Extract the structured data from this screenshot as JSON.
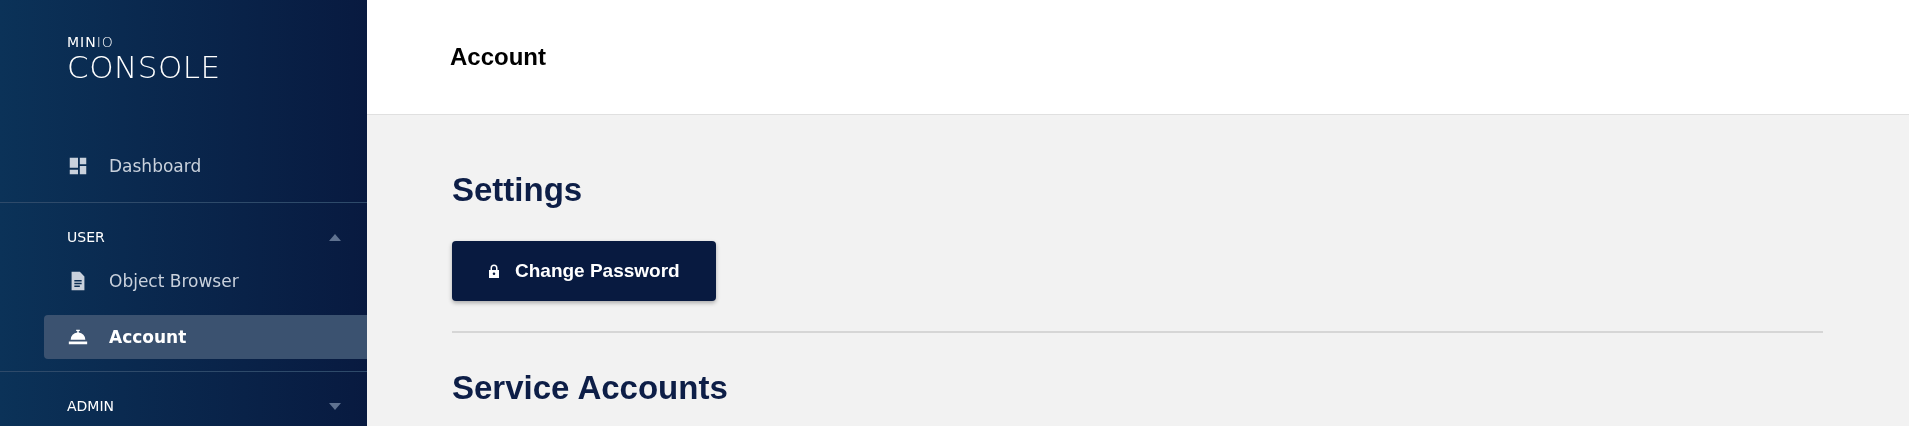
{
  "sidebar": {
    "logo": {
      "brand": "**MIN**IO",
      "product": "CONSOLE"
    },
    "items": [
      {
        "label": "Dashboard",
        "selected": false
      }
    ],
    "sections": [
      {
        "label": "USER",
        "expanded": true,
        "items": [
          {
            "label": "Object Browser",
            "selected": false
          },
          {
            "label": "Account",
            "selected": true
          }
        ]
      },
      {
        "label": "ADMIN",
        "expanded": false
      }
    ]
  },
  "header": {
    "title": "Account"
  },
  "content": {
    "sections": [
      {
        "heading": "Settings",
        "buttons": [
          "Change Password"
        ]
      },
      {
        "heading": "Service Accounts"
      }
    ]
  }
}
